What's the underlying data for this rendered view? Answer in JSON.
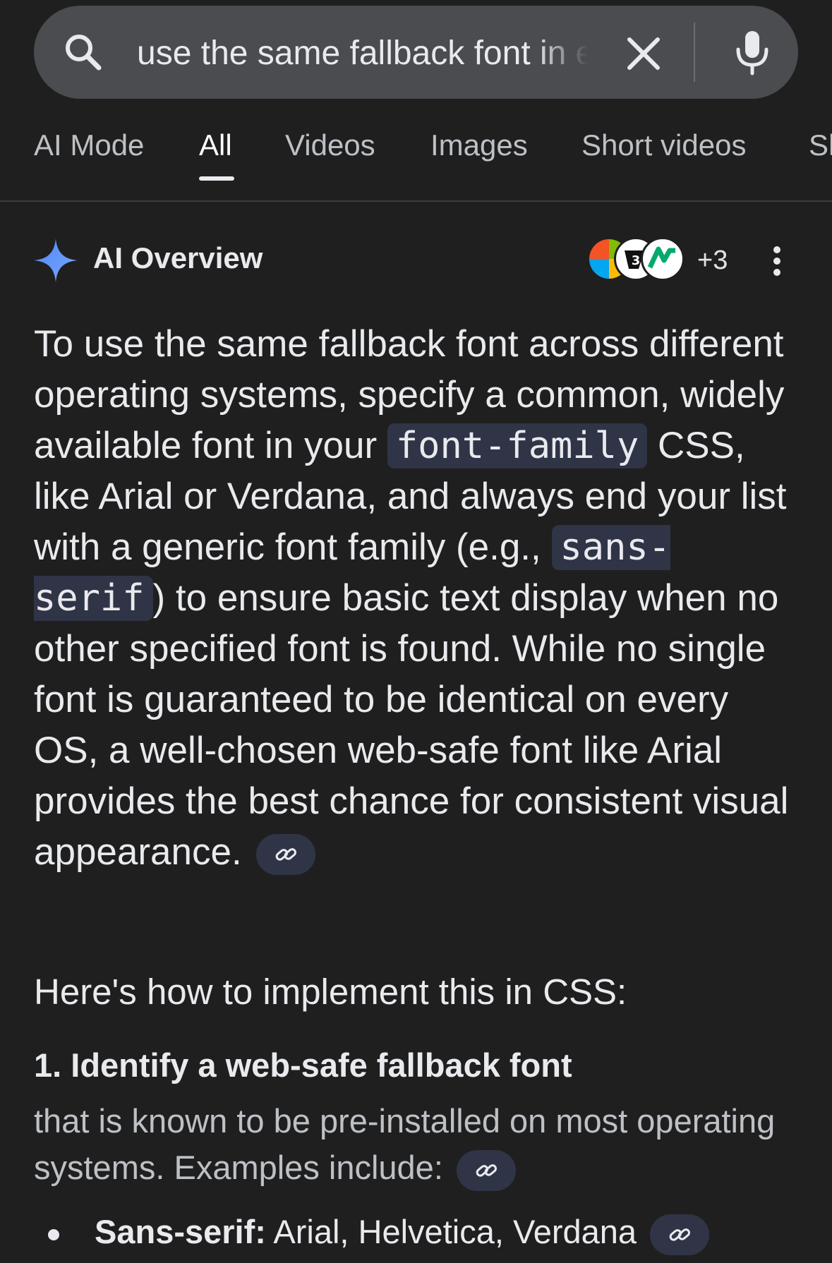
{
  "search": {
    "query": "use the same fallback font in every operating system"
  },
  "tabs": [
    "AI Mode",
    "All",
    "Videos",
    "Images",
    "Short videos",
    "Sh"
  ],
  "active_tab": "All",
  "ai_overview": {
    "title": "AI Overview",
    "sources_more": "+3",
    "para": {
      "t1": "To use the same fallback font across different operating systems, specify a common, widely available font in your ",
      "code1": "font-family",
      "t2": " CSS, like Arial or Verdana, and always end your list with a generic font family (e.g., ",
      "code2": "sans-serif",
      "t3": ") to ensure basic text display when no other specified font is found. While no single font is guaranteed to be identical on every OS, a well-chosen web-safe font like Arial provides the best chance for consistent visual appearance."
    },
    "section_heading": "Here's how to implement this in CSS:",
    "step1": {
      "title": "1. Identify a web-safe fallback font",
      "desc": "that is known to be pre-installed on most operating systems. Examples include:"
    },
    "bullet1": {
      "label": "Sans-serif:",
      "value": " Arial, Helvetica, Verdana"
    }
  },
  "colors": {
    "background": "#1f1f1f",
    "searchbar": "#4a4c50",
    "code_bg": "#303447",
    "sparkle": "#5b8def"
  }
}
